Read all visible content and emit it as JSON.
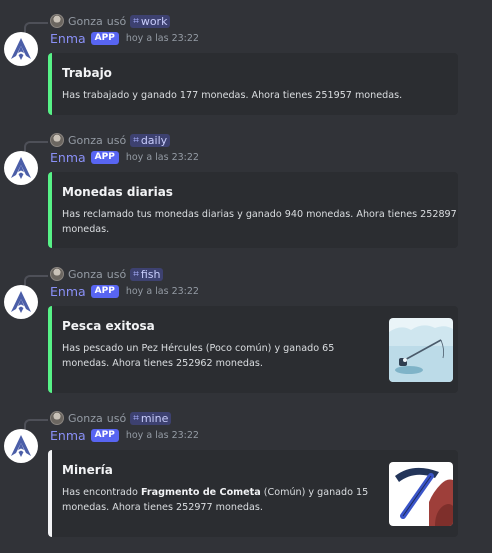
{
  "messages": [
    {
      "reply_user": "Gonza",
      "reply_verb": "usó",
      "command": "work",
      "bot_name": "Enma",
      "badge": "APP",
      "timestamp": "hoy a las 23:22",
      "embed": {
        "title": "Trabajo",
        "description_lines": [
          "Has trabajado y ganado 177 monedas. Ahora tienes 251957 monedas."
        ],
        "color": "#57f287"
      }
    },
    {
      "reply_user": "Gonza",
      "reply_verb": "usó",
      "command": "daily",
      "bot_name": "Enma",
      "badge": "APP",
      "timestamp": "hoy a las 23:22",
      "embed": {
        "title": "Monedas diarias",
        "description_lines": [
          "Has reclamado tus monedas diarias y ganado 940 monedas. Ahora tienes 252897",
          "monedas."
        ],
        "color": "#57f287"
      }
    },
    {
      "reply_user": "Gonza",
      "reply_verb": "usó",
      "command": "fish",
      "bot_name": "Enma",
      "badge": "APP",
      "timestamp": "hoy a las 23:22",
      "embed": {
        "title": "Pesca exitosa",
        "description_lines": [
          "Has pescado un Pez Hércules (Poco común) y ganado 65",
          "monedas. Ahora tienes 252962 monedas."
        ],
        "color": "#57f287",
        "thumbnail": "ice-fishing-icon"
      }
    },
    {
      "reply_user": "Gonza",
      "reply_verb": "usó",
      "command": "mine",
      "bot_name": "Enma",
      "badge": "APP",
      "timestamp": "hoy a las 23:22",
      "embed": {
        "title": "Minería",
        "description_pre": "Has encontrado ",
        "description_bold": "Fragmento de Cometa",
        "description_post": " (Común) y ganado 15",
        "description_line2": "monedas. Ahora tienes 252977 monedas.",
        "color": "#f2f3f5",
        "thumbnail": "pickaxe-icon"
      }
    }
  ]
}
